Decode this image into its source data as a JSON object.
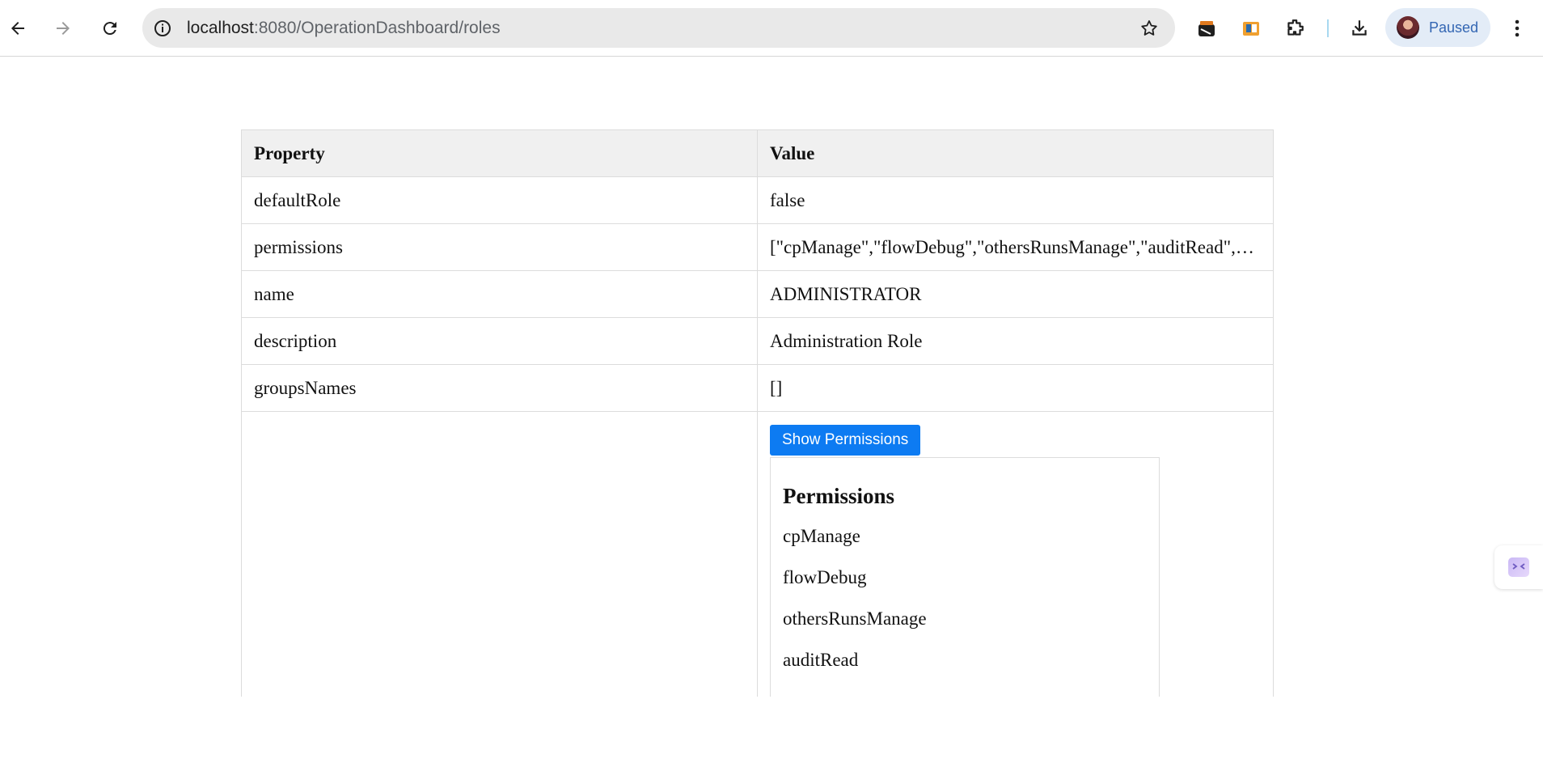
{
  "browser": {
    "url_host": "localhost",
    "url_rest": ":8080/OperationDashboard/roles",
    "profile_label": "Paused"
  },
  "table": {
    "headers": {
      "property": "Property",
      "value": "Value"
    },
    "rows": [
      {
        "property": "defaultRole",
        "value": "false"
      },
      {
        "property": "permissions",
        "value": "[\"cpManage\",\"flowDebug\",\"othersRunsManage\",\"auditRead\",\"reportRead\"]"
      },
      {
        "property": "name",
        "value": "ADMINISTRATOR"
      },
      {
        "property": "description",
        "value": "Administration Role"
      },
      {
        "property": "groupsNames",
        "value": "[]"
      }
    ]
  },
  "permissions_panel": {
    "button_label": "Show Permissions",
    "title": "Permissions",
    "items": [
      "cpManage",
      "flowDebug",
      "othersRunsManage",
      "auditRead"
    ]
  },
  "colors": {
    "button_bg": "#0d7bf2",
    "header_bg": "#f0f0f0",
    "profile_chip": "#e3ecf7"
  }
}
